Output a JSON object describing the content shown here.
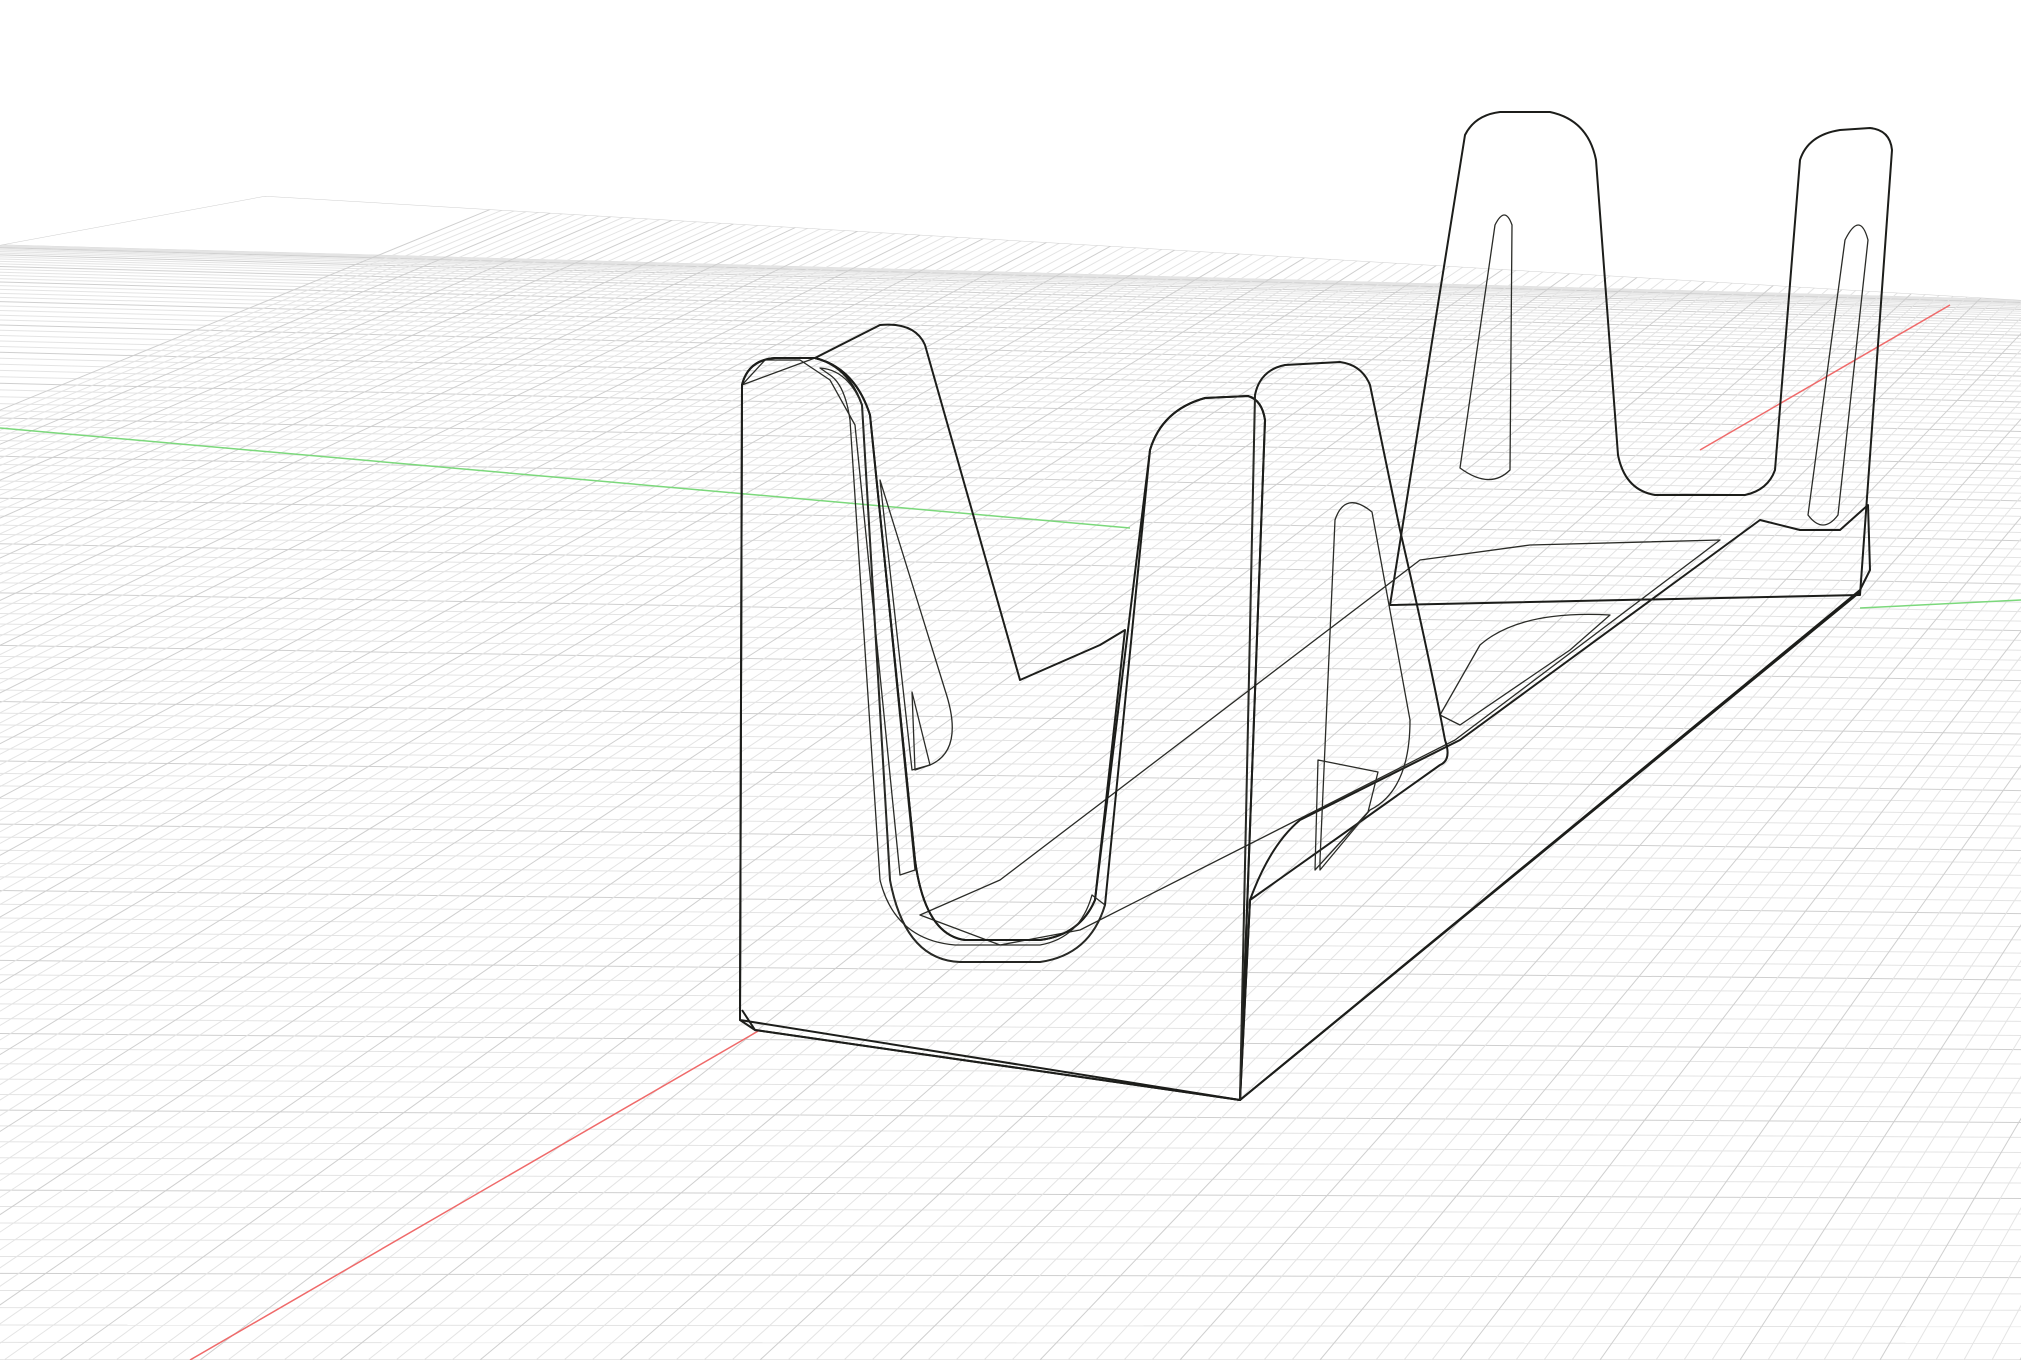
{
  "app": {
    "view": "3d-viewport"
  },
  "colors": {
    "background": "#ffffff",
    "grid_minor": "#e4e4e4",
    "grid_major": "#cfcfcf",
    "axis_x": "#ef6a6a",
    "axis_y": "#7bd87b",
    "model_front": "#4a4a44",
    "model_side": "#64645d",
    "model_top": "#8c8c84",
    "model_inner": "#3a3a35",
    "edge": "#1c1d1a"
  },
  "icons": {
    "ground_grid": "grid-plane-icon",
    "model": "solid-body-icon"
  }
}
